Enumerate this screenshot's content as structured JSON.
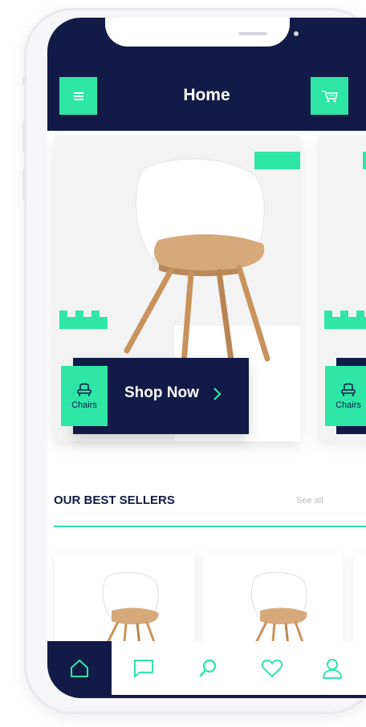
{
  "colors": {
    "navy": "#121a47",
    "accent": "#2ee6a6",
    "muted": "#b8b8c0"
  },
  "header": {
    "title": "Home",
    "menu_icon": "menu-icon",
    "cart_icon": "cart-icon"
  },
  "hero": {
    "cta_label": "Shop Now",
    "category_label": "Chairs",
    "category_label_next": "Chairs"
  },
  "best_sellers": {
    "title": "OUR BEST SELLERS",
    "see_all": "See all"
  },
  "tabbar": {
    "items": [
      {
        "icon": "home-icon",
        "active": true
      },
      {
        "icon": "chat-icon",
        "active": false
      },
      {
        "icon": "search-icon",
        "active": false
      },
      {
        "icon": "heart-icon",
        "active": false
      },
      {
        "icon": "user-icon",
        "active": false
      }
    ]
  }
}
